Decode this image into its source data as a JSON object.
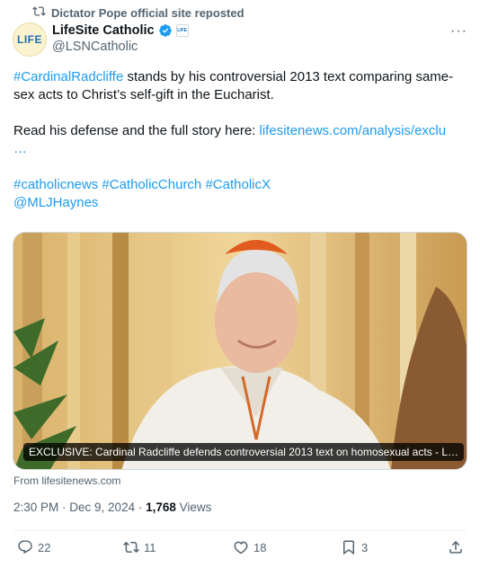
{
  "repost_banner": {
    "text": "Dictator Pope official site reposted",
    "icon": "repost-icon"
  },
  "author": {
    "avatar_text": "LIFE",
    "name": "LifeSite Catholic",
    "handle": "@LSNCatholic",
    "verified_color": "#1d9bf0",
    "affiliate_badge_text": "LIFE"
  },
  "tweet": {
    "line1_hashtag": "#CardinalRadcliffe",
    "line1_rest": " stands by his controversial 2013 text comparing same-sex acts to Christ’s self-gift in the Eucharist.",
    "line2_prefix": "Read his defense and the full story here: ",
    "line2_link": "lifesitenews.com/analysis/exclu",
    "line2_ellipsis": "…",
    "hashtags": [
      "#catholicnews",
      "#CatholicChurch",
      "#CatholicX"
    ],
    "mention": "@MLJHaynes"
  },
  "card": {
    "caption": "EXCLUSIVE: Cardinal Radcliffe defends controversial 2013 text on homosexual acts - L…",
    "source": "From lifesitenews.com"
  },
  "meta": {
    "time": "2:30 PM",
    "sep1": " · ",
    "date": "Dec 9, 2024",
    "sep2": " · ",
    "views_count": "1,768",
    "views_label": " Views"
  },
  "actions": {
    "replies": "22",
    "reposts": "11",
    "likes": "18",
    "bookmarks": "3"
  },
  "colors": {
    "link": "#1d9bf0",
    "secondary": "#536471",
    "text": "#0f1419"
  }
}
